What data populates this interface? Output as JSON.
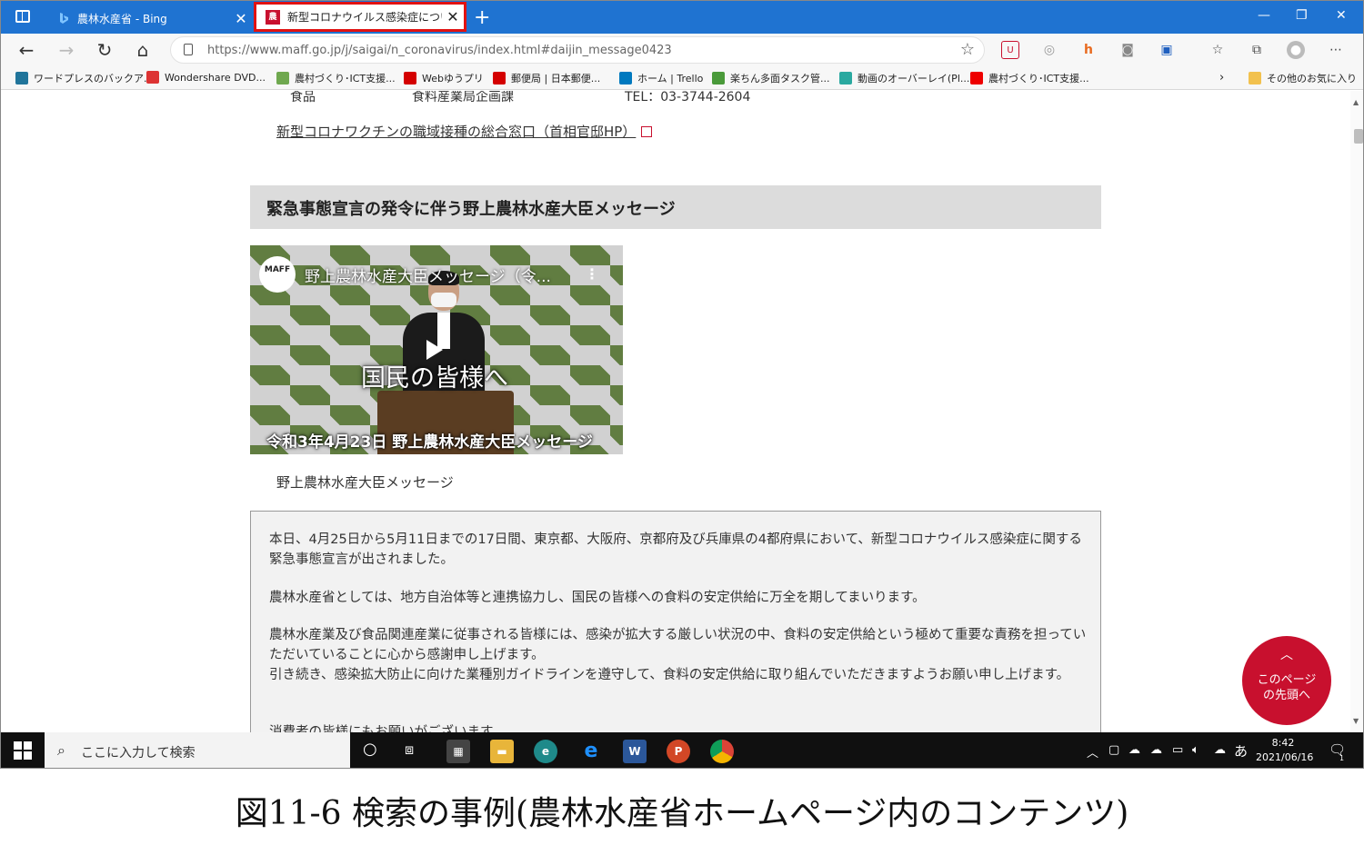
{
  "browser": {
    "tabs": [
      {
        "title": "農林水産省 - Bing",
        "icon": "bing-icon"
      },
      {
        "title": "新型コロナウイルス感染症について：",
        "icon": "maff-icon"
      }
    ],
    "url": "https://www.maff.go.jp/j/saigai/n_coronavirus/index.html#daijin_message0423",
    "bookmarks": [
      "ワードプレスのバックア...",
      "Wondershare DVD...",
      "農村づくり･ICT支援...",
      "Webゆうプリ",
      "郵便局 | 日本郵便...",
      "ホーム | Trello",
      "楽ちん多面タスク管...",
      "動画のオーバーレイ(Pl...",
      "農村づくり･ICT支援..."
    ],
    "other_bookmarks": "その他のお気に入り",
    "accent_color": "#1f73d1",
    "highlight_color": "#e01212"
  },
  "page": {
    "cut_row": [
      "食品",
      "食料産業局企画課",
      "TEL：03-3744-2604"
    ],
    "vaccine_link": "新型コロナワクチンの職域接種の総合窓口（首相官邸HP）",
    "section_heading": "緊急事態宣言の発令に伴う野上農林水産大臣メッセージ",
    "video": {
      "logo": "MAFF",
      "title": "野上農林水産大臣メッセージ（令...",
      "overlay": "国民の皆様へ",
      "caption": "令和3年4月23日 野上農林水産大臣メッセージ"
    },
    "video_label": "野上農林水産大臣メッセージ",
    "message": [
      "本日、4月25日から5月11日までの17日間、東京都、大阪府、京都府及び兵庫県の4都府県において、新型コロナウイルス感染症に関する緊急事態宣言が出されました。",
      "農林水産省としては、地方自治体等と連携協力し、国民の皆様への食料の安定供給に万全を期してまいります。",
      "農林水産業及び食品関連産業に従事される皆様には、感染が拡大する厳しい状況の中、食料の安定供給という極めて重要な責務を担っていただいていることに心から感謝申し上げます。",
      "引き続き、感染拡大防止に向けた業種別ガイドラインを遵守して、食料の安定供給に取り組んでいただきますようお願い申し上げます。",
      "消費者の皆様にもお願いがございます。"
    ],
    "back_to_top": "このページ\nの先頭へ"
  },
  "taskbar": {
    "search_placeholder": "ここに入力して検索",
    "ime": "あ",
    "time": "8:42",
    "date": "2021/06/16",
    "notification_count": "1"
  },
  "figure_caption": "図11-6 検索の事例(農林水産省ホームページ内のコンテンツ)"
}
